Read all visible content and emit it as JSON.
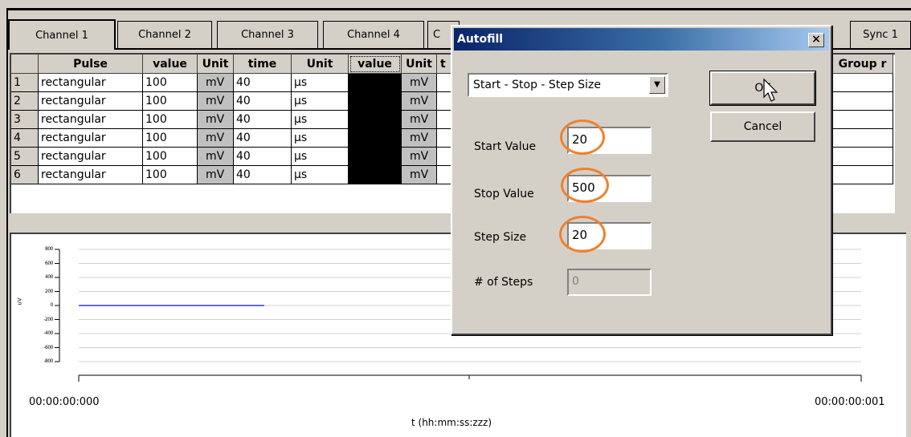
{
  "tabs": [
    "Channel 1",
    "Channel 2",
    "Channel 3",
    "Channel 4",
    "C",
    "Sync 1"
  ],
  "grid": {
    "headers": [
      "",
      "Pulse",
      "value",
      "Unit",
      "time",
      "Unit",
      "value",
      "Unit",
      "t",
      "Group r"
    ],
    "rows": [
      {
        "num": "1",
        "pulse": "rectangular",
        "value": "100",
        "unit": "mV",
        "time": "40",
        "unit2": "µs",
        "unit3": "mV"
      },
      {
        "num": "2",
        "pulse": "rectangular",
        "value": "100",
        "unit": "mV",
        "time": "40",
        "unit2": "µs",
        "unit3": "mV"
      },
      {
        "num": "3",
        "pulse": "rectangular",
        "value": "100",
        "unit": "mV",
        "time": "40",
        "unit2": "µs",
        "unit3": "mV"
      },
      {
        "num": "4",
        "pulse": "rectangular",
        "value": "100",
        "unit": "mV",
        "time": "40",
        "unit2": "µs",
        "unit3": "mV"
      },
      {
        "num": "5",
        "pulse": "rectangular",
        "value": "100",
        "unit": "mV",
        "time": "40",
        "unit2": "µs",
        "unit3": "mV"
      },
      {
        "num": "6",
        "pulse": "rectangular",
        "value": "100",
        "unit": "mV",
        "time": "40",
        "unit2": "µs",
        "unit3": "mV"
      }
    ]
  },
  "chart": {
    "ytick_labels": [
      "800",
      "600",
      "400",
      "200",
      "0",
      "-200",
      "-400",
      "-600",
      "-800"
    ],
    "yaxis_label": "uV",
    "x_start": "00:00:00:000",
    "x_end": "00:00:00:001",
    "xlabel": "t (hh:mm:ss:zzz)",
    "line_color": "#3333ff"
  },
  "dialog": {
    "title": "Autofill",
    "close_label": "×",
    "mode_selected": "Start - Stop - Step Size",
    "ok_label": "OK",
    "cancel_label": "Cancel",
    "start_label": "Start Value",
    "start_value": "20",
    "stop_label": "Stop Value",
    "stop_value": "500",
    "step_label": "Step Size",
    "step_value": "20",
    "nsteps_label": "# of Steps",
    "nsteps_value": "0",
    "highlight_color": "#f0812a"
  }
}
